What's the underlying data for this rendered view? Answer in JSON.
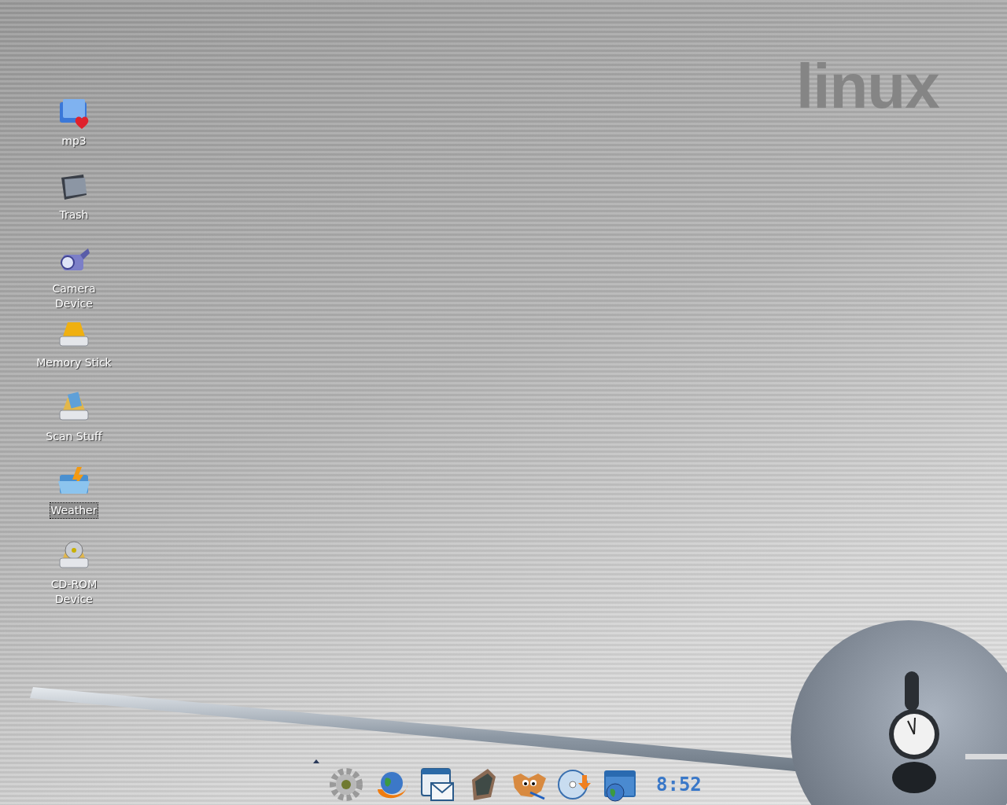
{
  "wallpaper": {
    "logo_text": "linux"
  },
  "desktop_icons": [
    {
      "kind": "music-folder",
      "label": "mp3",
      "selected": false
    },
    {
      "kind": "trash",
      "label": "Trash",
      "selected": false
    },
    {
      "kind": "camera",
      "label": "Camera Device",
      "selected": false
    },
    {
      "kind": "drive",
      "label": "Memory Stick",
      "selected": false
    },
    {
      "kind": "scanner",
      "label": "Scan Stuff",
      "selected": false
    },
    {
      "kind": "weather-folder",
      "label": "Weather",
      "selected": true
    },
    {
      "kind": "cdrom",
      "label": "CD-ROM Device",
      "selected": false
    }
  ],
  "panel": {
    "launchers": [
      {
        "kind": "gear"
      },
      {
        "kind": "browser"
      },
      {
        "kind": "mail-calendar"
      },
      {
        "kind": "tablet"
      },
      {
        "kind": "paint"
      },
      {
        "kind": "cd-download"
      },
      {
        "kind": "network-folder"
      }
    ],
    "clock": "8:52"
  }
}
